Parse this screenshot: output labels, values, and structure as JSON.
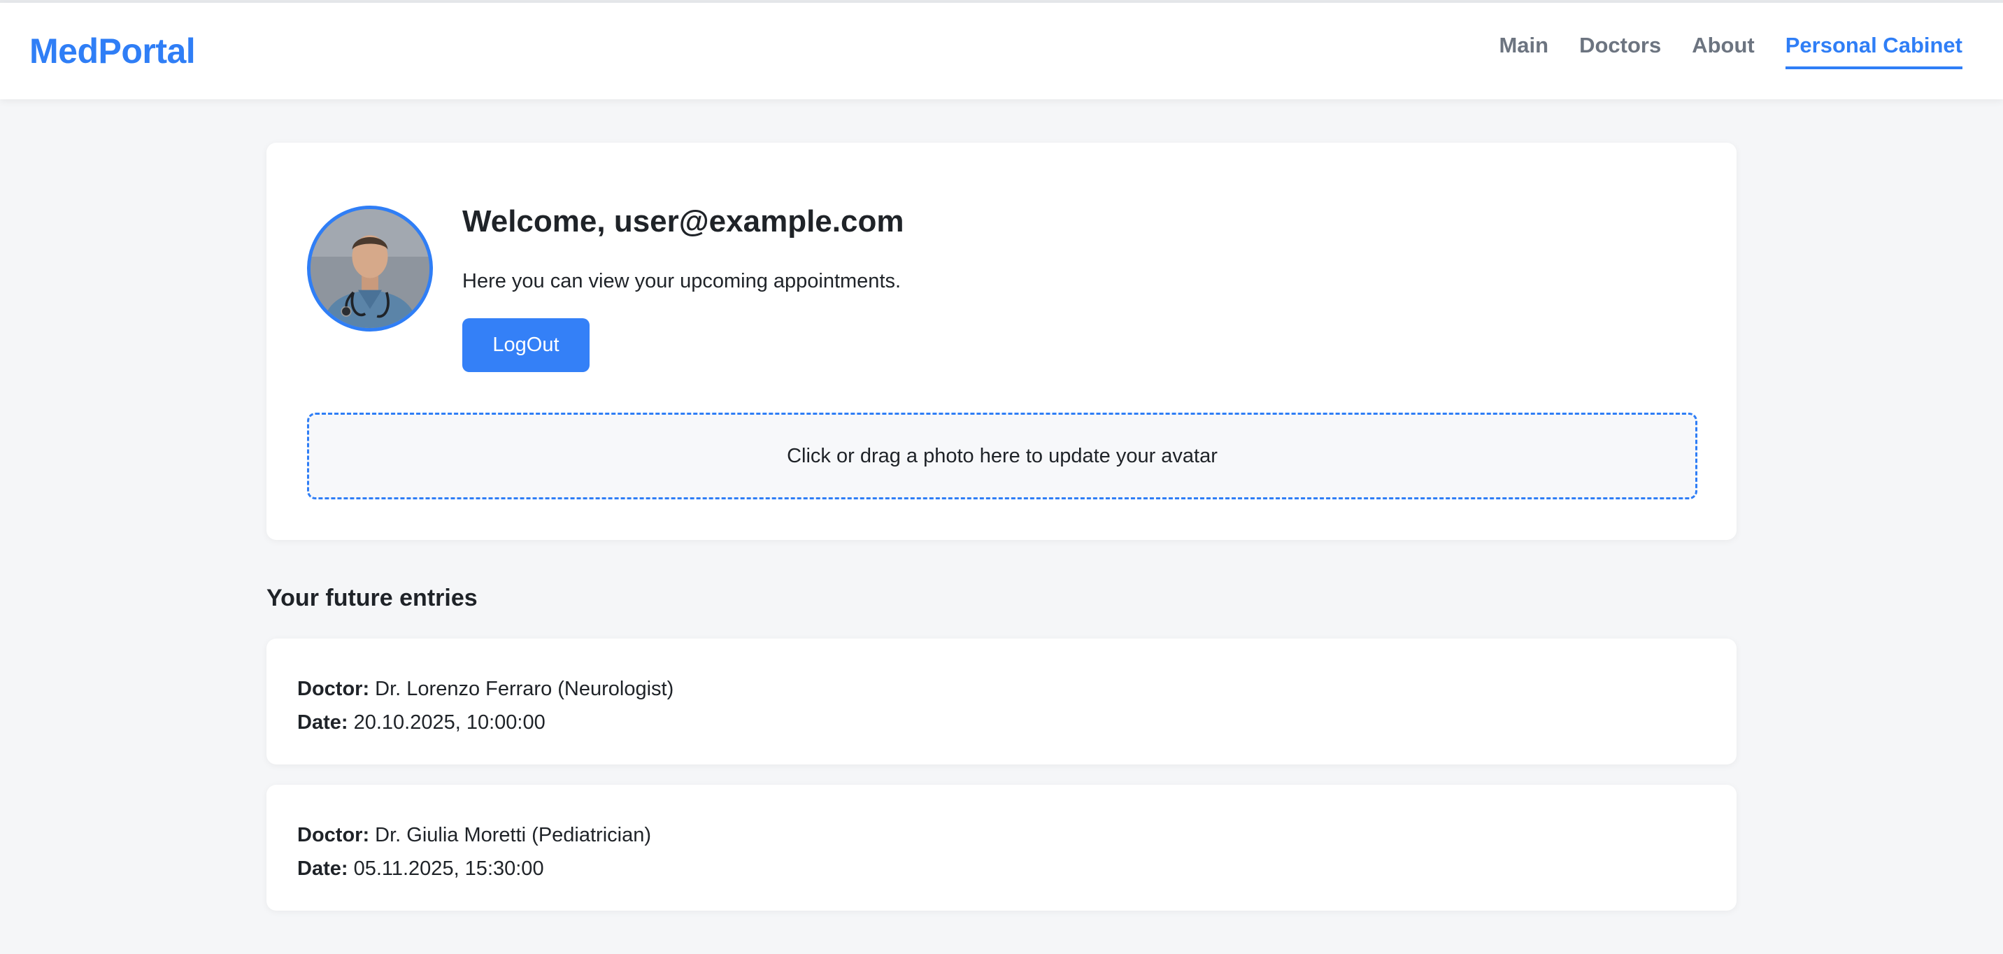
{
  "header": {
    "brand": "MedPortal",
    "nav": [
      {
        "label": "Main",
        "active": false
      },
      {
        "label": "Doctors",
        "active": false
      },
      {
        "label": "About",
        "active": false
      },
      {
        "label": "Personal Cabinet",
        "active": true
      }
    ]
  },
  "profile": {
    "welcome": "Welcome, user@example.com",
    "subtitle": "Here you can view your upcoming appointments.",
    "logout_label": "LogOut",
    "dropzone_text": "Click or drag a photo here to update your avatar"
  },
  "entries_section": {
    "title": "Your future entries",
    "doctor_label": "Doctor:",
    "date_label": "Date:",
    "items": [
      {
        "doctor": "Dr. Lorenzo Ferraro (Neurologist)",
        "date": "20.10.2025, 10:00:00"
      },
      {
        "doctor": "Dr. Giulia Moretti (Pediatrician)",
        "date": "05.11.2025, 15:30:00"
      }
    ]
  },
  "colors": {
    "accent": "#2f7ef6",
    "background": "#f5f6f8",
    "nav_inactive": "#6c7480"
  }
}
